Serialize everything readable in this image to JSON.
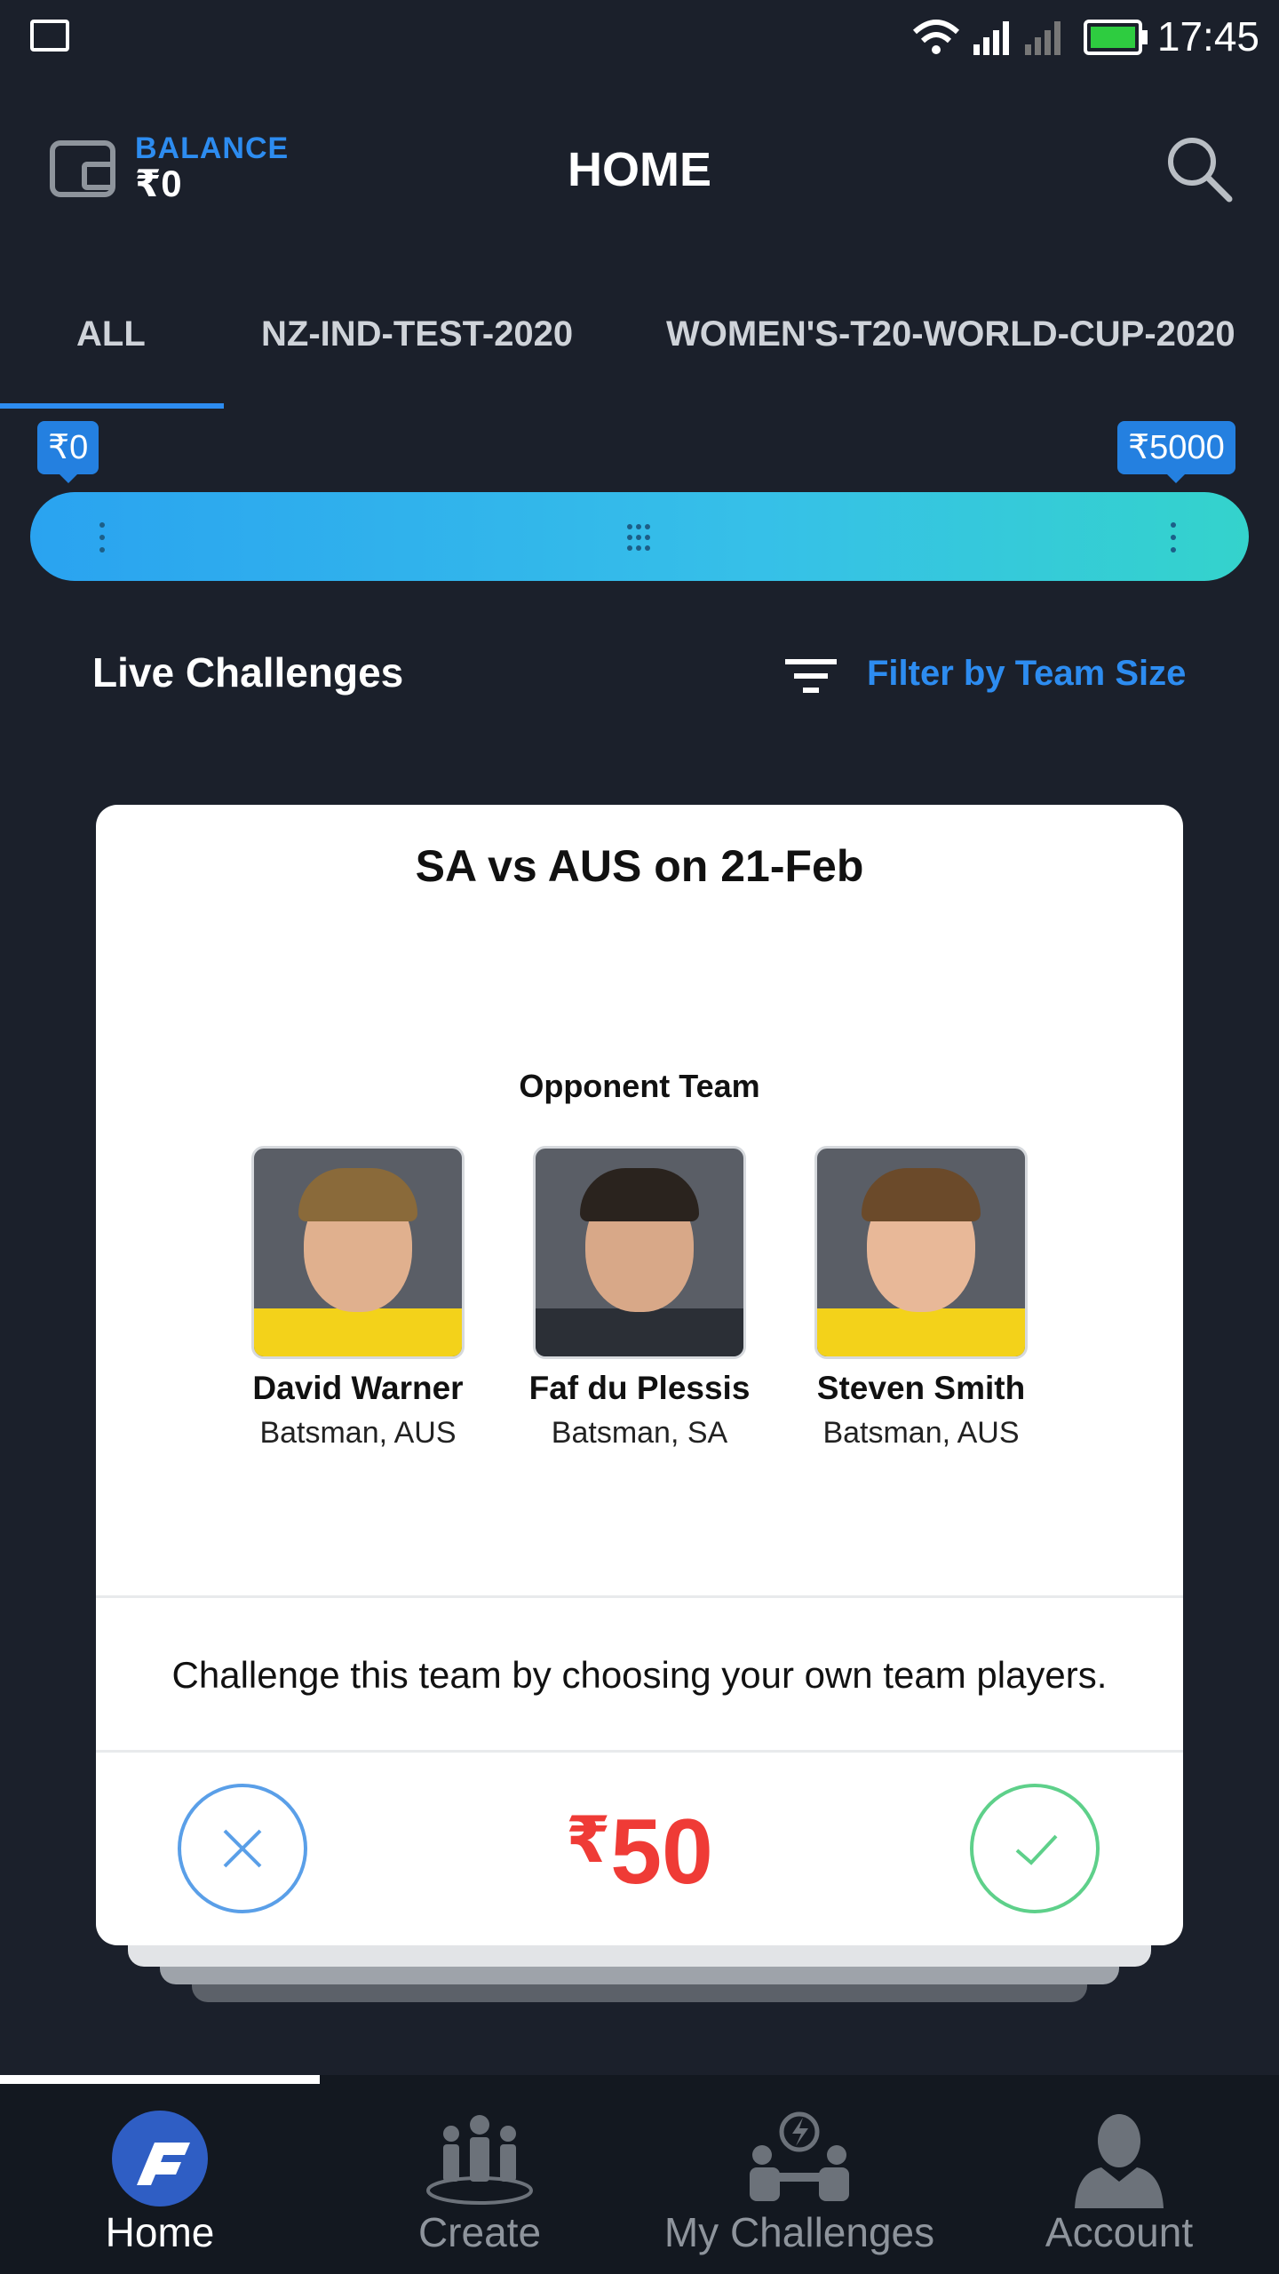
{
  "status_bar": {
    "time": "17:45"
  },
  "header": {
    "balance_label": "BALANCE",
    "balance_value": "₹0",
    "title": "HOME"
  },
  "tabs": [
    {
      "label": "ALL",
      "active": true
    },
    {
      "label": "NZ-IND-TEST-2020",
      "active": false
    },
    {
      "label": "WOMEN'S-T20-WORLD-CUP-2020",
      "active": false
    }
  ],
  "price_range": {
    "min_label": "₹0",
    "max_label": "₹5000"
  },
  "live": {
    "title": "Live Challenges",
    "filter_label": "Filter by Team Size"
  },
  "card": {
    "match_title": "SA vs AUS on 21-Feb",
    "opponent_title": "Opponent Team",
    "players": [
      {
        "name": "David Warner",
        "role": "Batsman, AUS"
      },
      {
        "name": "Faf du Plessis",
        "role": "Batsman, SA"
      },
      {
        "name": "Steven Smith",
        "role": "Batsman, AUS"
      }
    ],
    "challenge_text": "Challenge this team by choosing your own team players.",
    "price_currency": "₹",
    "price_amount": "50"
  },
  "bottom_nav": [
    {
      "label": "Home",
      "icon": "home-logo-icon",
      "active": true
    },
    {
      "label": "Create",
      "icon": "team-create-icon",
      "active": false
    },
    {
      "label": "My Challenges",
      "icon": "challenges-icon",
      "active": false
    },
    {
      "label": "Account",
      "icon": "account-icon",
      "active": false
    }
  ],
  "colors": {
    "background": "#1b202b",
    "accent_blue": "#2d8cf0",
    "price_red": "#ef3b36",
    "accept_green": "#5ed08a"
  }
}
